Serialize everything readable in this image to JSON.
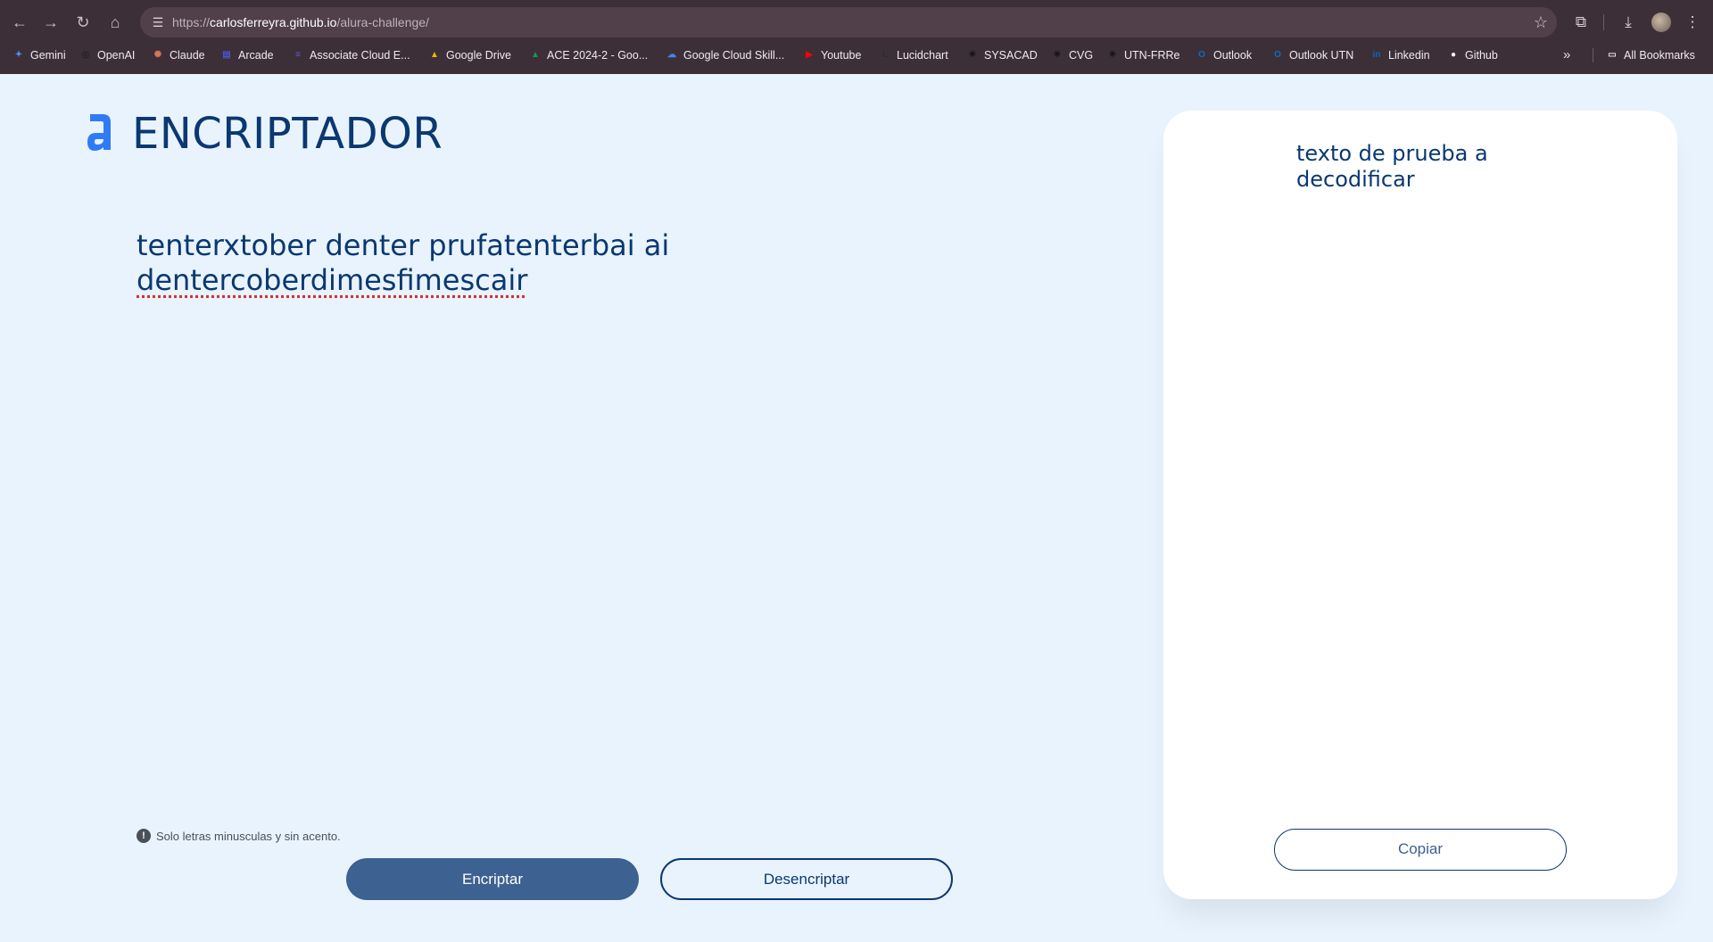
{
  "browser": {
    "url_scheme": "https://",
    "url_host": "carlosferreyra.github.io",
    "url_path": "/alura-challenge/",
    "bookmarks": [
      {
        "label": "Gemini",
        "icon": "gemini-icon",
        "color": "#4e8df5"
      },
      {
        "label": "OpenAI",
        "icon": "openai-icon",
        "color": "#222222"
      },
      {
        "label": "Claude",
        "icon": "claude-icon",
        "color": "#d97757"
      },
      {
        "label": "Arcade",
        "icon": "arcade-icon",
        "color": "#4a55d1"
      },
      {
        "label": "Associate Cloud E...",
        "icon": "list-icon",
        "color": "#5b5fd6"
      },
      {
        "label": "Google Drive",
        "icon": "drive-icon",
        "color": "#f4b400"
      },
      {
        "label": "ACE 2024-2 - Goo...",
        "icon": "drive-icon",
        "color": "#0f9d58"
      },
      {
        "label": "Google Cloud Skill...",
        "icon": "cloud-icon",
        "color": "#4285f4"
      },
      {
        "label": "Youtube",
        "icon": "youtube-icon",
        "color": "#ff0000"
      },
      {
        "label": "Lucidchart",
        "icon": "lucidchart-icon",
        "color": "#282c33"
      },
      {
        "label": "SYSACAD",
        "icon": "utn-icon",
        "color": "#111111"
      },
      {
        "label": "CVG",
        "icon": "utn-icon",
        "color": "#111111"
      },
      {
        "label": "UTN-FRRe",
        "icon": "utn-icon",
        "color": "#111111"
      },
      {
        "label": "Outlook",
        "icon": "outlook-icon",
        "color": "#0f6cbd"
      },
      {
        "label": "Outlook UTN",
        "icon": "outlook-icon",
        "color": "#0f6cbd"
      },
      {
        "label": "Linkedin",
        "icon": "linkedin-icon",
        "color": "#0a66c2"
      },
      {
        "label": "Github",
        "icon": "github-icon",
        "color": "#ffffff"
      }
    ],
    "all_bookmarks": "All Bookmarks"
  },
  "page": {
    "brand": "ENCRIPTADOR",
    "input_line1": "tenterxtober denter prufatenterbai ai",
    "input_line2": "dentercoberdimesfimescair",
    "hint": "Solo letras minusculas y sin acento.",
    "encrypt_label": "Encriptar",
    "decrypt_label": "Desencriptar",
    "output_text": "texto de prueba a decodificar",
    "copy_label": "Copiar",
    "colors": {
      "brand": "#0a3871",
      "accent": "#3d6190",
      "background": "#e9f3fd"
    }
  }
}
